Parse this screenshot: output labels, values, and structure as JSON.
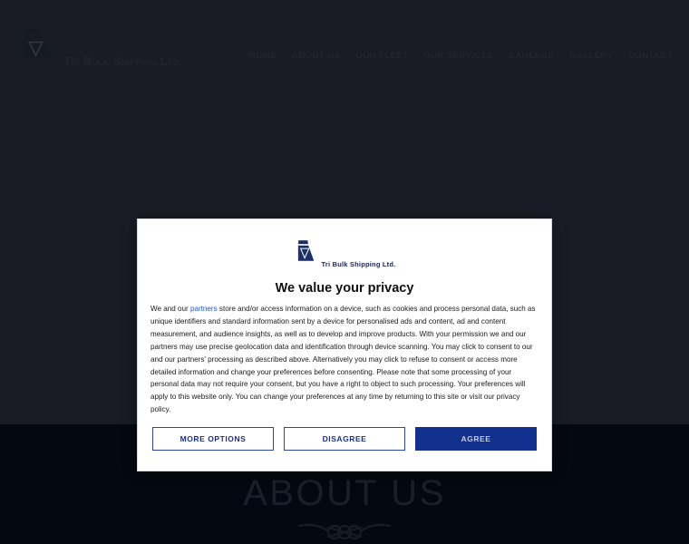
{
  "site": {
    "brand": {
      "name": "Tri Bulk Shipping Ltd.",
      "logo_icon": "ship-funnel-logo-icon"
    },
    "nav": {
      "items": [
        {
          "label": "HOME"
        },
        {
          "label": "ABOUT US"
        },
        {
          "label": "OUR FLEET"
        },
        {
          "label": "OUR SERVICES"
        },
        {
          "label": "CAREERS"
        },
        {
          "label": "GALLERY"
        },
        {
          "label": "CONTACT"
        }
      ]
    },
    "hero": {
      "title": "ABOUT US",
      "divider_icon": "rope-knot-divider-icon"
    },
    "colors": {
      "header_bg": "#191c24",
      "hero_bg": "#040810",
      "nav_text": "#21252f",
      "hero_title": "#1b1f29"
    }
  },
  "consent_modal": {
    "brand": {
      "name": "Tri Bulk Shipping Ltd.",
      "logo_icon": "ship-funnel-logo-icon"
    },
    "title": "We value your privacy",
    "body": {
      "lead": "We and our ",
      "partners_link": "partners",
      "rest": " store and/or access information on a device, such as cookies and process personal data, such as unique identifiers and standard information sent by a device for personalised ads and content, ad and content measurement, and audience insights, as well as to develop and improve products. With your permission we and our partners may use precise geolocation data and identification through device scanning. You may click to consent to our and our partners' processing as described above. Alternatively you may click to refuse to consent or access more detailed information and change your preferences before consenting. Please note that some processing of your personal data may not require your consent, but you have a right to object to such processing. Your preferences will apply to this website only. You can change your preferences at any time by returning to this site or visit our privacy policy."
    },
    "buttons": {
      "more_options": "MORE OPTIONS",
      "disagree": "DISAGREE",
      "agree": "AGREE"
    },
    "colors": {
      "link": "#1a56db",
      "outline_border": "#2b46a8",
      "outline_text": "#16309a",
      "agree_bg": "#12318f",
      "agree_text": "#c3cbe4",
      "modal_bg": "#ffffff"
    }
  }
}
